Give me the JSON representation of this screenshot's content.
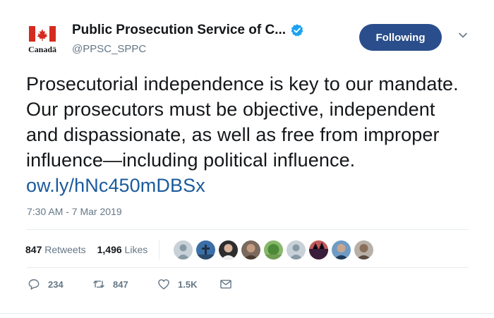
{
  "account": {
    "logo_wordmark": "Canadä",
    "display_name": "Public Prosecution Service of C...",
    "handle": "@PPSC_SPPC",
    "verified": true
  },
  "follow_button": {
    "label": "Following"
  },
  "tweet": {
    "text": "Prosecutorial independence is key to our mandate. Our prosecutors must be objective, independent and dispassionate, as well as free from improper influence—including political influence. ",
    "link_text": "ow.ly/hNc450mDBSx",
    "timestamp": "7:30 AM - 7 Mar 2019"
  },
  "stats": {
    "retweets_count": "847",
    "retweets_label": "Retweets",
    "likes_count": "1,496",
    "likes_label": "Likes"
  },
  "liker_avatars": [
    "default-avatar",
    "tower-photo",
    "person-photo",
    "person-photo",
    "landscape-photo",
    "default-avatar",
    "sunset-photo",
    "person-photo",
    "person-photo"
  ],
  "actions": {
    "reply_count": "234",
    "retweet_count": "847",
    "like_count": "1.5K"
  },
  "icons": {
    "reply": "reply-icon",
    "retweet": "retweet-icon",
    "like": "heart-icon",
    "message": "envelope-icon",
    "caret": "chevron-down-icon",
    "verified": "verified-badge-icon"
  },
  "colors": {
    "follow_button": "#2a4e8c",
    "link": "#1b5a9c",
    "canada_red": "#d52b1e",
    "verified_blue": "#1da1f2"
  }
}
